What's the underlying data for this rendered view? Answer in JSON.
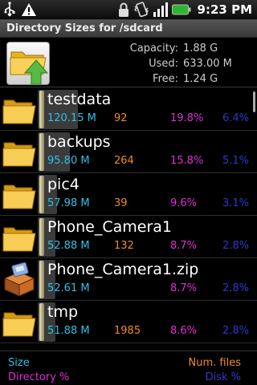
{
  "status_bar": {
    "time": "9:23 PM",
    "icons": [
      "usb-icon",
      "warning-icon",
      "lock-icon",
      "vibrate-icon",
      "signal-icon",
      "battery-icon"
    ]
  },
  "title": "Directory Sizes for /sdcard",
  "summary": {
    "capacity_label": "Capacity:",
    "capacity_value": "1.88 G",
    "used_label": "Used:",
    "used_value": "633.00 M",
    "free_label": "Free:",
    "free_value": "1.24 G"
  },
  "rows": [
    {
      "name": "testdata",
      "size": "120.15 M",
      "files": "92",
      "dir_pct": "19.8%",
      "disk_pct": "6.4%",
      "icon": "folder-icon",
      "fraction": 0.198
    },
    {
      "name": "backups",
      "size": "95.80 M",
      "files": "264",
      "dir_pct": "15.8%",
      "disk_pct": "5.1%",
      "icon": "folder-icon",
      "fraction": 0.158
    },
    {
      "name": "pic4",
      "size": "57.98 M",
      "files": "39",
      "dir_pct": "9.6%",
      "disk_pct": "3.1%",
      "icon": "folder-icon",
      "fraction": 0.096
    },
    {
      "name": "Phone_Camera1",
      "size": "52.88 M",
      "files": "132",
      "dir_pct": "8.7%",
      "disk_pct": "2.8%",
      "icon": "folder-icon",
      "fraction": 0.087
    },
    {
      "name": "Phone_Camera1.zip",
      "size": "52.61 M",
      "files": "",
      "dir_pct": "8.7%",
      "disk_pct": "2.8%",
      "icon": "zip-archive-icon",
      "fraction": 0.087
    },
    {
      "name": "tmp",
      "size": "51.88 M",
      "files": "1985",
      "dir_pct": "8.6%",
      "disk_pct": "2.8%",
      "icon": "folder-icon",
      "fraction": 0.086
    }
  ],
  "legend": {
    "size": "Size",
    "files": "Num. files",
    "dir_pct": "Directory %",
    "disk_pct": "Disk %"
  },
  "colors": {
    "size": "#2ec2e8",
    "files": "#f08a24",
    "dir_pct": "#e02ed8",
    "disk_pct": "#3038c8"
  }
}
